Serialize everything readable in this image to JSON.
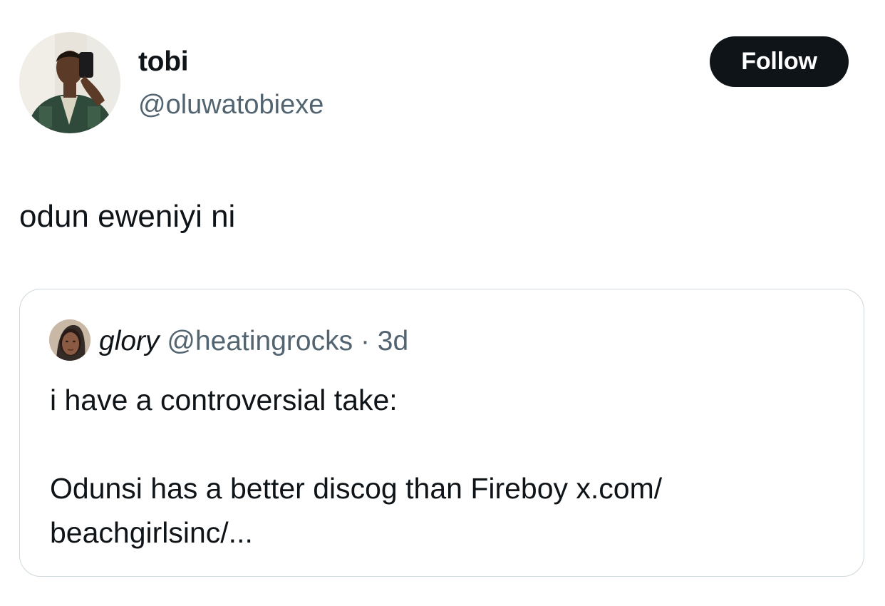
{
  "author": {
    "display_name": "tobi",
    "handle": "@oluwatobiexe",
    "avatar_icon": "profile-photo"
  },
  "follow_button": {
    "label": "Follow",
    "bg_color": "#0f1419",
    "text_color": "#ffffff"
  },
  "tweet": {
    "text": "odun eweniyi ni"
  },
  "quoted_tweet": {
    "display_name": "glory",
    "handle": "@heatingrocks",
    "separator": "·",
    "time": "3d",
    "avatar_icon": "profile-photo",
    "lines": [
      "i have a controversial take:",
      "",
      "Odunsi has a better discog than Fireboy x.com/",
      "beachgirlsinc/..."
    ]
  },
  "colors": {
    "text_primary": "#0f1419",
    "text_secondary": "#536471",
    "border": "#cfd9de"
  }
}
